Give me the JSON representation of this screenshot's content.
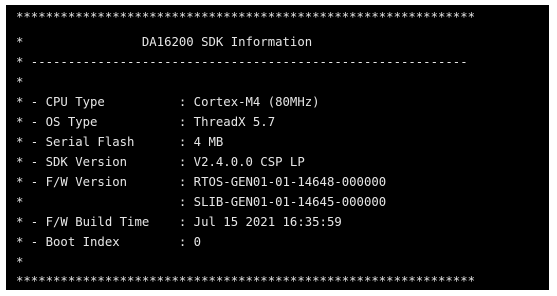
{
  "window": {
    "background": "#000000",
    "text_color": "#e6e6e6"
  },
  "console": {
    "lines": [
      "**************************************************************",
      "*                DA16200 SDK Information",
      "* -----------------------------------------------------------",
      "*",
      "* - CPU Type          : Cortex-M4 (80MHz)",
      "* - OS Type           : ThreadX 5.7",
      "* - Serial Flash      : 4 MB",
      "* - SDK Version       : V2.4.0.0 CSP LP",
      "* - F/W Version       : RTOS-GEN01-01-14648-000000",
      "*                     : SLIB-GEN01-01-14645-000000",
      "* - F/W Build Time    : Jul 15 2021 16:35:59",
      "* - Boot Index        : 0",
      "*",
      "**************************************************************"
    ]
  }
}
